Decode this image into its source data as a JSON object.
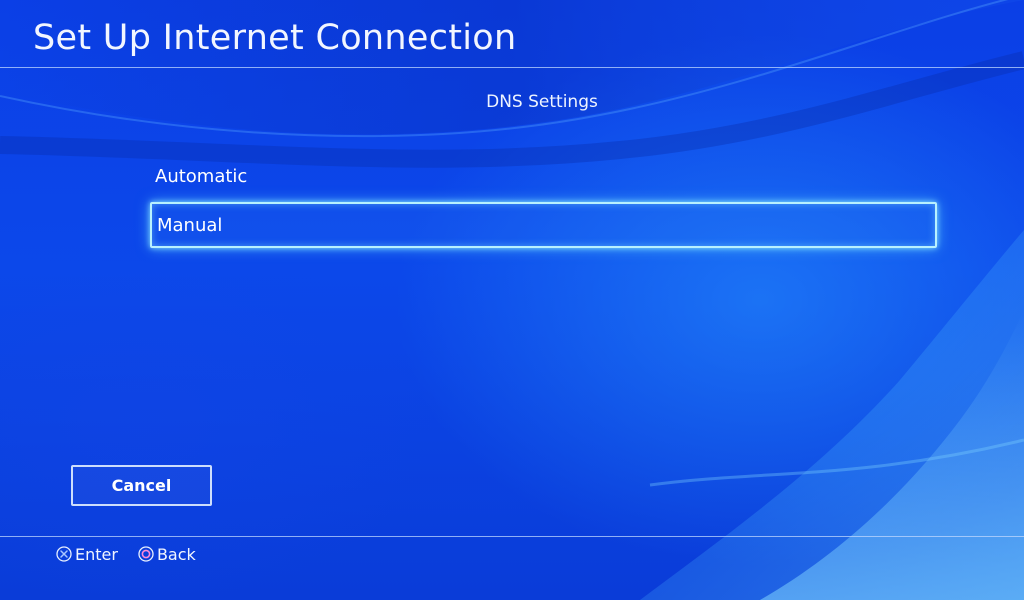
{
  "header": {
    "title": "Set Up Internet Connection"
  },
  "section": {
    "title": "DNS Settings"
  },
  "menu": {
    "items": [
      {
        "label": "Automatic",
        "selected": false
      },
      {
        "label": "Manual",
        "selected": true
      }
    ]
  },
  "actions": {
    "cancel_label": "Cancel"
  },
  "footer": {
    "hints": [
      {
        "icon": "cross-button-icon",
        "label": "Enter"
      },
      {
        "icon": "circle-button-icon",
        "label": "Back"
      }
    ]
  },
  "colors": {
    "background": "#0b3fe6",
    "highlight": "#b8f1ff",
    "text": "#ffffff"
  }
}
